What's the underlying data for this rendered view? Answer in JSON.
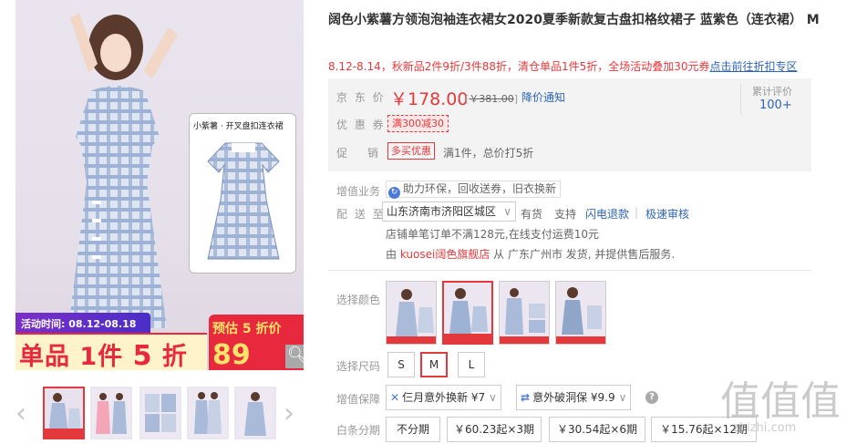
{
  "gallery": {
    "inset_label": "小紫薯 · 开叉盘扣连衣裙",
    "promo_time": "活动时间: 08.12-08.18",
    "promo_text_a": "单品 1件 ",
    "promo_text_five": "5",
    "promo_text_b": " 折",
    "presale_label": "预估 5 折价",
    "presale_price": "89",
    "thumb_count": 5,
    "selected_thumb": 0
  },
  "product": {
    "title": "阔色小紫薯方领泡泡袖连衣裙女2020夏季新款复古盘扣格纹裙子 蓝紫色（连衣裙） M",
    "promo_line": "8.12-8.14，秋新品2件9折/3件88折，清仓单品1件5折，全场活动叠加30元券",
    "promo_link": "点击前往折扣专区"
  },
  "price_box": {
    "price_label": "京 东 价",
    "price": "￥178.00",
    "old_prefix": "[",
    "old_price": "￥381.00",
    "old_suffix": "]",
    "notice": "降价通知",
    "review_label": "累计评价",
    "review_count": "100+",
    "coupon_label": "优 惠 券",
    "coupon": "满300减30",
    "promo_label": "促　 销",
    "promo_tag": "多买优惠",
    "promo_desc": "满1件，总价打5折"
  },
  "service": {
    "label": "增值业务",
    "text": "助力环保，回收送券，旧衣换新"
  },
  "delivery": {
    "label": "配 送 至",
    "region": "山东济南市济阳区城区",
    "stock": "有货",
    "support": "支持",
    "link1": "闪电退款",
    "divider": "|",
    "link2": "极速审核",
    "ship_note": "店铺单笔订单不满128元,在线支付运费10元",
    "shop_prefix": "由 ",
    "shop": "kuosei阔色旗舰店",
    "shop_suffix": " 从 广东广州市 发货, 并提供售后服务."
  },
  "colors": {
    "label": "选择颜色",
    "count": 4,
    "selected": 1
  },
  "sizes": {
    "label": "选择尺码",
    "options": [
      "S",
      "M",
      "L"
    ],
    "selected": "M"
  },
  "guarantee": {
    "label": "增值保障",
    "opt1": "仨月意外换新 ¥7",
    "opt2": "意外破洞保 ¥9.9"
  },
  "installment": {
    "label": "白条分期",
    "options": [
      "不分期",
      "￥60.23起×3期",
      "￥30.54起×6期",
      "￥15.76起×12期"
    ]
  },
  "watermark": {
    "big": "值值值",
    "url": "zhizhi.com"
  },
  "colors_theme": {
    "accent": "#e4393c",
    "link": "#2d64b3",
    "plaid": "#8fa6c9"
  }
}
